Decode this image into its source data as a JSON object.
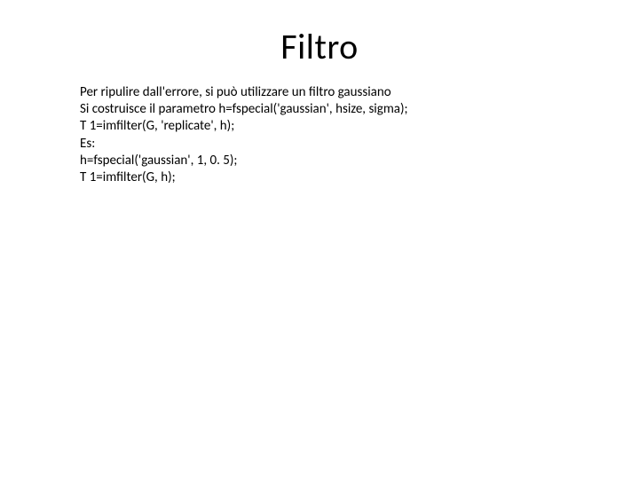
{
  "title": "Filtro",
  "lines": [
    "Per ripulire dall'errore, si può utilizzare un filtro gaussiano",
    "Si costruisce il parametro h=fspecial('gaussian', hsize, sigma);",
    "T 1=imfilter(G, 'replicate', h);",
    "Es:",
    "h=fspecial('gaussian', 1, 0. 5);",
    " T 1=imfilter(G, h);"
  ]
}
